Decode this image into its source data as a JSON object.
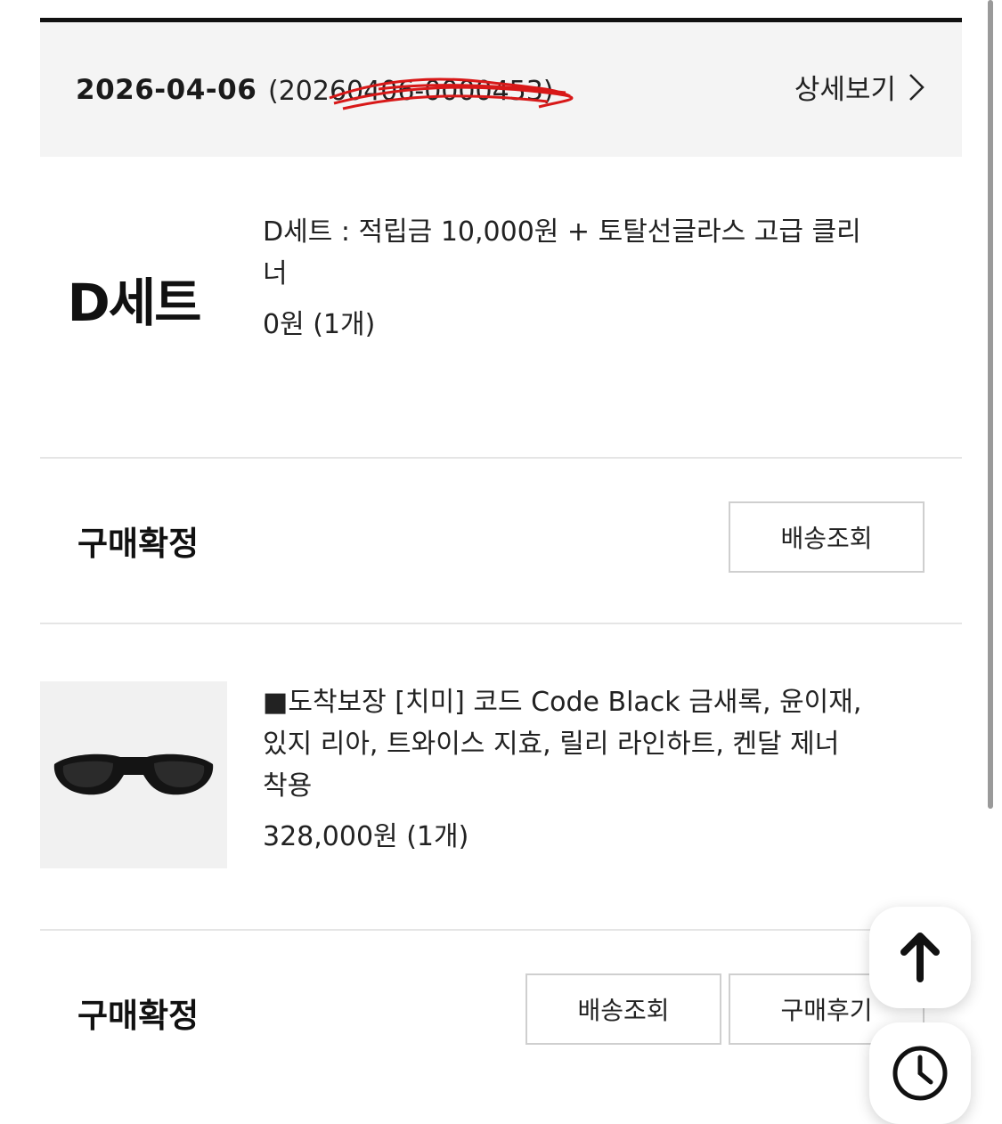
{
  "order": {
    "date": "2026-04-06",
    "number": "(20260406-0000453)",
    "detail_label": "상세보기"
  },
  "items": [
    {
      "thumb_text": "D세트",
      "title": "D세트 : 적립금 10,000원 + 토탈선글라스 고급 클리너",
      "price": "0원 (1개)",
      "status": "구매확정",
      "buttons": [
        "배송조회"
      ]
    },
    {
      "thumb_icon": "sunglasses-image",
      "title": "■도착보장 [치미] 코드 Code Black 금새록, 윤이재, 있지 리아, 트와이스 지효, 릴리 라인하트, 켄달 제너 착용",
      "price": "328,000원 (1개)",
      "status": "구매확정",
      "buttons": [
        "배송조회",
        "구매후기"
      ]
    }
  ],
  "floating": {
    "top_icon": "arrow-up-icon",
    "recent_icon": "clock-icon"
  }
}
